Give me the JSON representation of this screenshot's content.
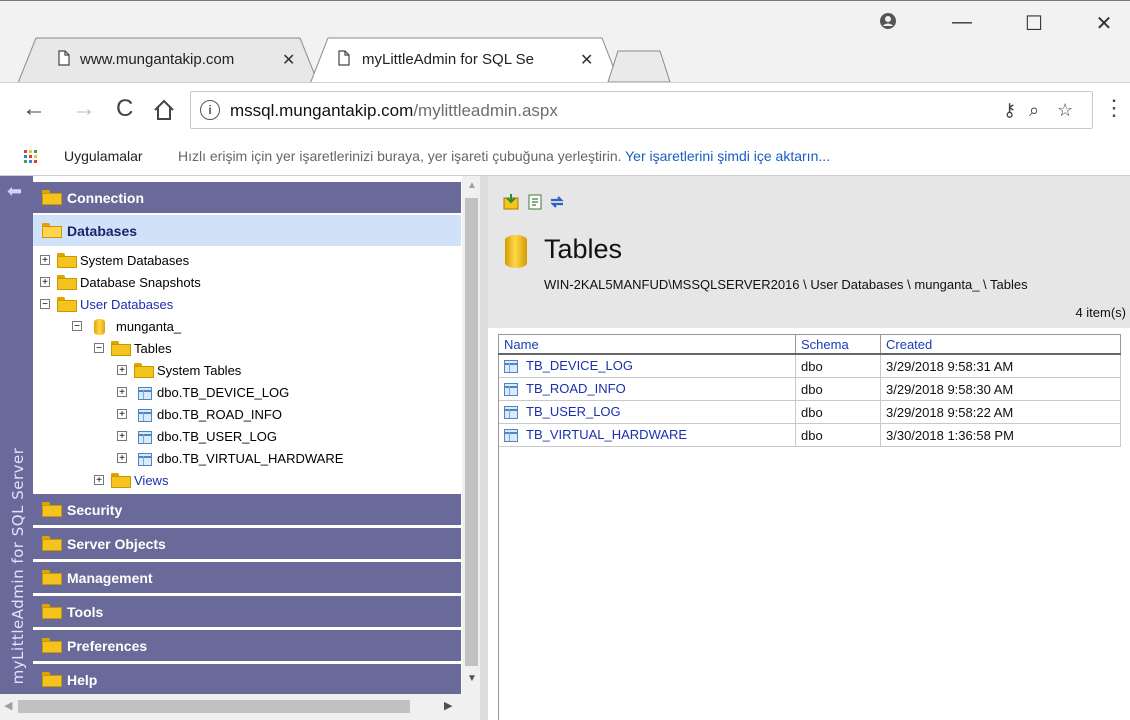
{
  "browser": {
    "tabs": [
      {
        "title": "www.mungantakip.com",
        "close": "✕"
      },
      {
        "title": "myLittleAdmin for SQL Se",
        "close": "✕"
      }
    ],
    "address": {
      "host": "mssql.mungantakip.com",
      "path": "/mylittleadmin.aspx"
    },
    "bookmarks": {
      "apps": "Uygulamalar",
      "hint": "Hızlı erişim için yer işaretlerinizi buraya, yer işareti çubuğuna yerleştirin. ",
      "import_link": "Yer işaretlerini şimdi içe aktarın..."
    }
  },
  "sidebar": {
    "vertical_label": "myLittleAdmin for SQL Server",
    "sections": {
      "connection": "Connection",
      "databases": "Databases",
      "security": "Security",
      "server_objects": "Server Objects",
      "management": "Management",
      "tools": "Tools",
      "preferences": "Preferences",
      "help": "Help"
    },
    "tree": {
      "system_databases": "System Databases",
      "database_snapshots": "Database Snapshots",
      "user_databases": "User Databases",
      "db_name": "munganta_",
      "tables": "Tables",
      "system_tables": "System Tables",
      "t1": "dbo.TB_DEVICE_LOG",
      "t2": "dbo.TB_ROAD_INFO",
      "t3": "dbo.TB_USER_LOG",
      "t4": "dbo.TB_VIRTUAL_HARDWARE",
      "views": "Views"
    }
  },
  "main": {
    "title": "Tables",
    "breadcrumb": "WIN-2KAL5MANFUD\\MSSQLSERVER2016 \\ User Databases \\ munganta_ \\ Tables",
    "item_count": "4 item(s)",
    "columns": {
      "name": "Name",
      "schema": "Schema",
      "created": "Created"
    },
    "rows": [
      {
        "name": "TB_DEVICE_LOG",
        "schema": "dbo",
        "created": "3/29/2018 9:58:31 AM"
      },
      {
        "name": "TB_ROAD_INFO",
        "schema": "dbo",
        "created": "3/29/2018 9:58:30 AM"
      },
      {
        "name": "TB_USER_LOG",
        "schema": "dbo",
        "created": "3/29/2018 9:58:22 AM"
      },
      {
        "name": "TB_VIRTUAL_HARDWARE",
        "schema": "dbo",
        "created": "3/30/2018 1:36:58 PM"
      }
    ]
  },
  "icons": {
    "back": "back-arrow-icon",
    "forward": "forward-arrow-icon",
    "reload": "reload-icon",
    "home": "home-icon",
    "key": "key-icon",
    "zoom": "zoom-icon",
    "star": "star-icon",
    "menu": "menu-dots-icon",
    "folder": "folder-icon",
    "database": "database-icon",
    "table": "table-icon"
  },
  "colors": {
    "sidebar": "#6a6a9a",
    "selected_section": "#cfe2f7",
    "link": "#1c2fb0",
    "header_link": "#1c3cb4"
  }
}
